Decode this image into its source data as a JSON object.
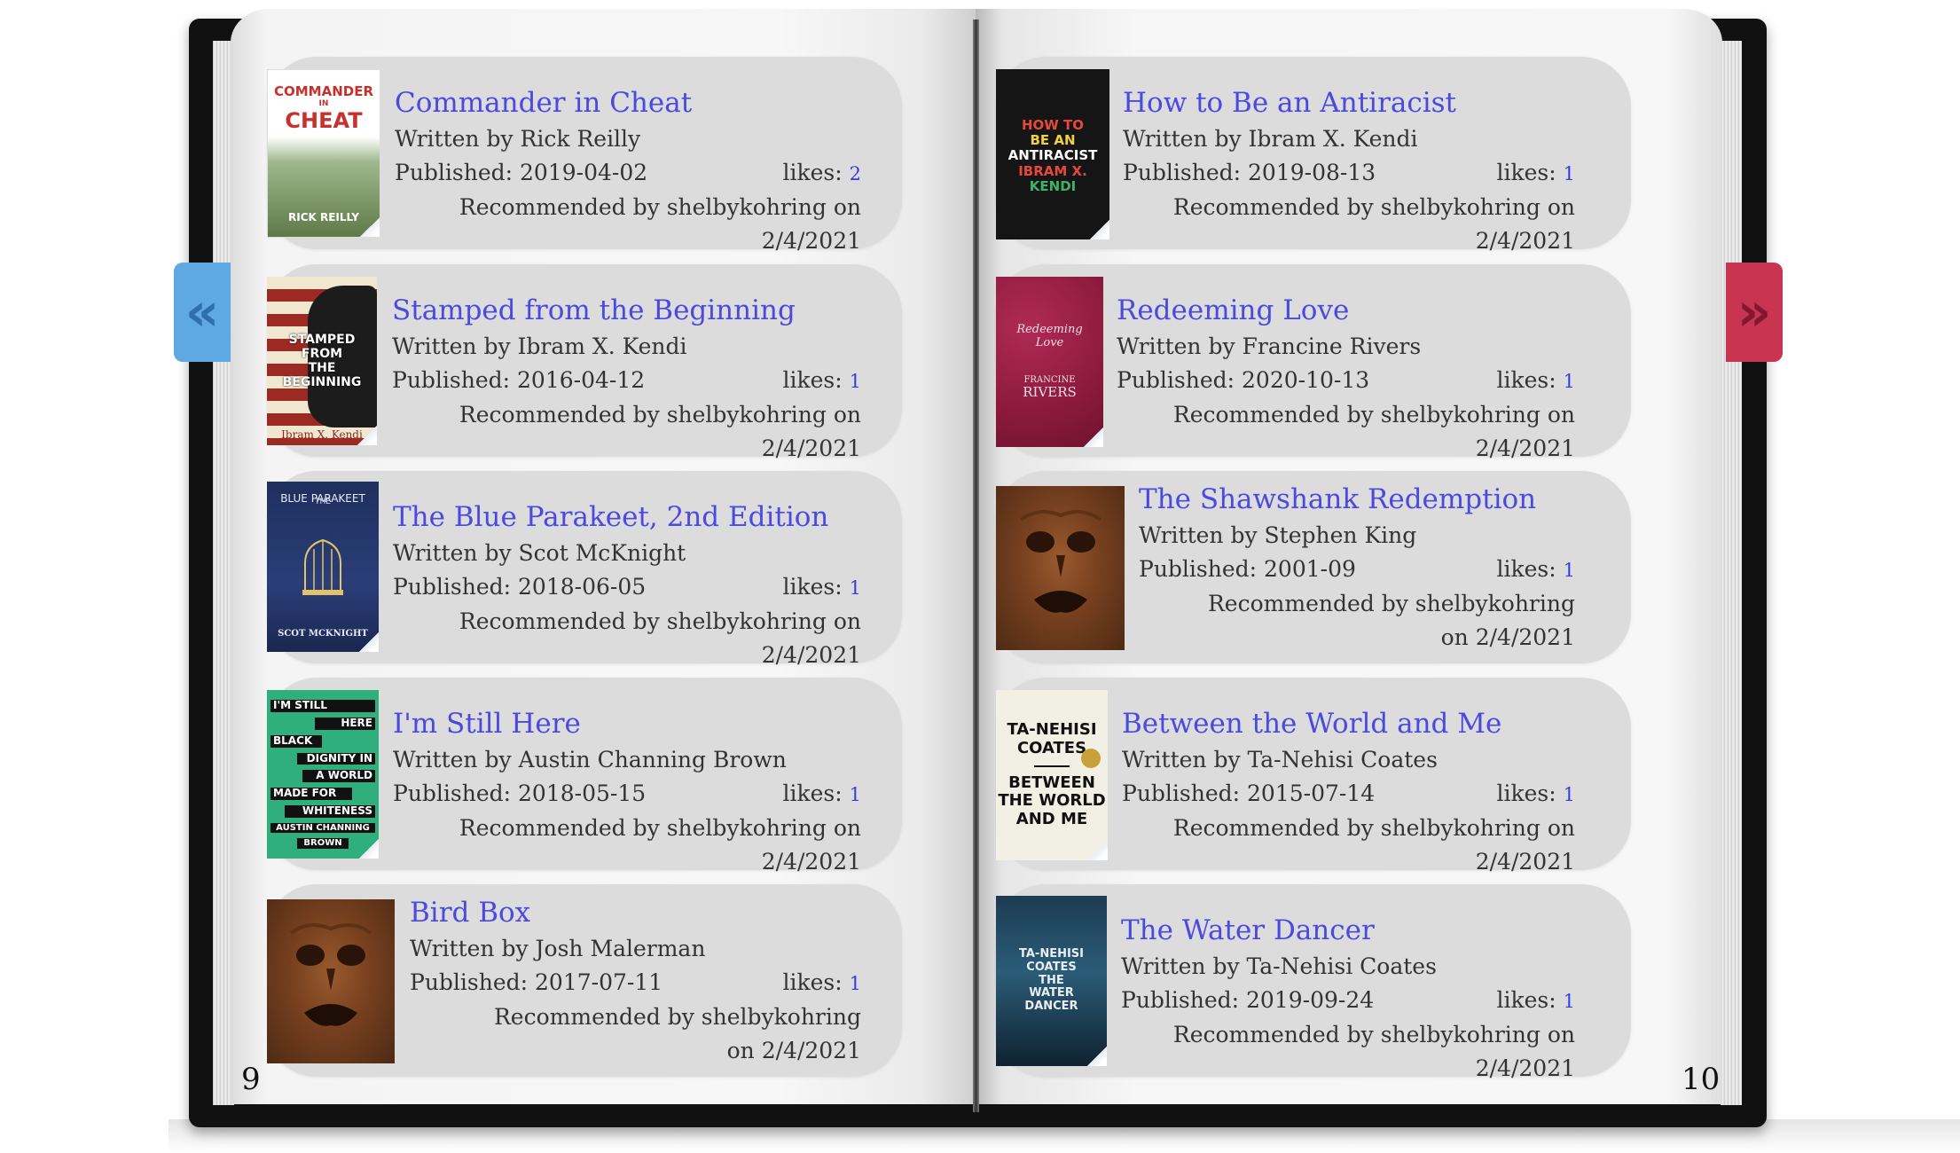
{
  "pages": {
    "left_number": "9",
    "right_number": "10"
  },
  "nav": {
    "prev_glyph": "«",
    "next_glyph": "»"
  },
  "labels": {
    "likes": "likes:"
  },
  "left_books": [
    {
      "title": "Commander in Cheat",
      "author": "Written by Rick Reilly",
      "published": "Published: 2019-04-02",
      "likes": "2",
      "recommended": "Recommended by shelbykohring on 2/4/2021",
      "cover_text": [
        "COMMANDER",
        "IN",
        "CHEAT",
        "RICK REILLY"
      ]
    },
    {
      "title": "Stamped from the Beginning",
      "author": "Written by Ibram X. Kendi",
      "published": "Published: 2016-04-12",
      "likes": "1",
      "recommended": "Recommended by shelbykohring on 2/4/2021",
      "cover_text": [
        "STAMPED",
        "FROM",
        "THE",
        "BEGINNING",
        "Ibram X. Kendi"
      ]
    },
    {
      "title": "The Blue Parakeet, 2nd Edition",
      "author": "Written by Scot McKnight",
      "published": "Published: 2018-06-05",
      "likes": "1",
      "recommended": "Recommended by shelbykohring on 2/4/2021",
      "cover_text": [
        "THE",
        "BLUE PARAKEET",
        "SCOT MCKNIGHT"
      ]
    },
    {
      "title": "I'm Still Here",
      "author": "Written by Austin Channing Brown",
      "published": "Published: 2018-05-15",
      "likes": "1",
      "recommended": "Recommended by shelbykohring on 2/4/2021",
      "cover_text": [
        "I'M STILL",
        "HERE",
        "BLACK",
        "DIGNITY IN",
        "A WORLD",
        "MADE FOR",
        "WHITENESS",
        "AUSTIN CHANNING",
        "BROWN"
      ]
    },
    {
      "title": "Bird Box",
      "author": "Written by Josh Malerman",
      "published": "Published: 2017-07-11",
      "likes": "1",
      "recommended": "Recommended by shelbykohring on 2/4/2021",
      "cover_text": []
    }
  ],
  "right_books": [
    {
      "title": "How to Be an Antiracist",
      "author": "Written by Ibram X. Kendi",
      "published": "Published: 2019-08-13",
      "likes": "1",
      "recommended": "Recommended by shelbykohring on 2/4/2021",
      "cover_text": [
        "HOW TO",
        "BE AN",
        "ANTIRACIST",
        "IBRAM X.",
        "KENDI"
      ]
    },
    {
      "title": "Redeeming Love",
      "author": "Written by Francine Rivers",
      "published": "Published: 2020-10-13",
      "likes": "1",
      "recommended": "Recommended by shelbykohring on 2/4/2021",
      "cover_text": [
        "Redeeming",
        "Love",
        "FRANCINE",
        "RIVERS"
      ]
    },
    {
      "title": "The Shawshank Redemption",
      "author": "Written by Stephen King",
      "published": "Published: 2001-09",
      "likes": "1",
      "recommended": "Recommended by shelbykohring on 2/4/2021",
      "cover_text": []
    },
    {
      "title": "Between the World and Me",
      "author": "Written by Ta-Nehisi Coates",
      "published": "Published: 2015-07-14",
      "likes": "1",
      "recommended": "Recommended by shelbykohring on 2/4/2021",
      "cover_text": [
        "TA-NEHISI",
        "COATES",
        "BETWEEN",
        "THE WORLD",
        "AND ME"
      ]
    },
    {
      "title": "The Water Dancer",
      "author": "Written by Ta-Nehisi Coates",
      "published": "Published: 2019-09-24",
      "likes": "1",
      "recommended": "Recommended by shelbykohring on 2/4/2021",
      "cover_text": [
        "TA-NEHISI",
        "COATES",
        "THE",
        "WATER",
        "DANCER"
      ]
    }
  ]
}
